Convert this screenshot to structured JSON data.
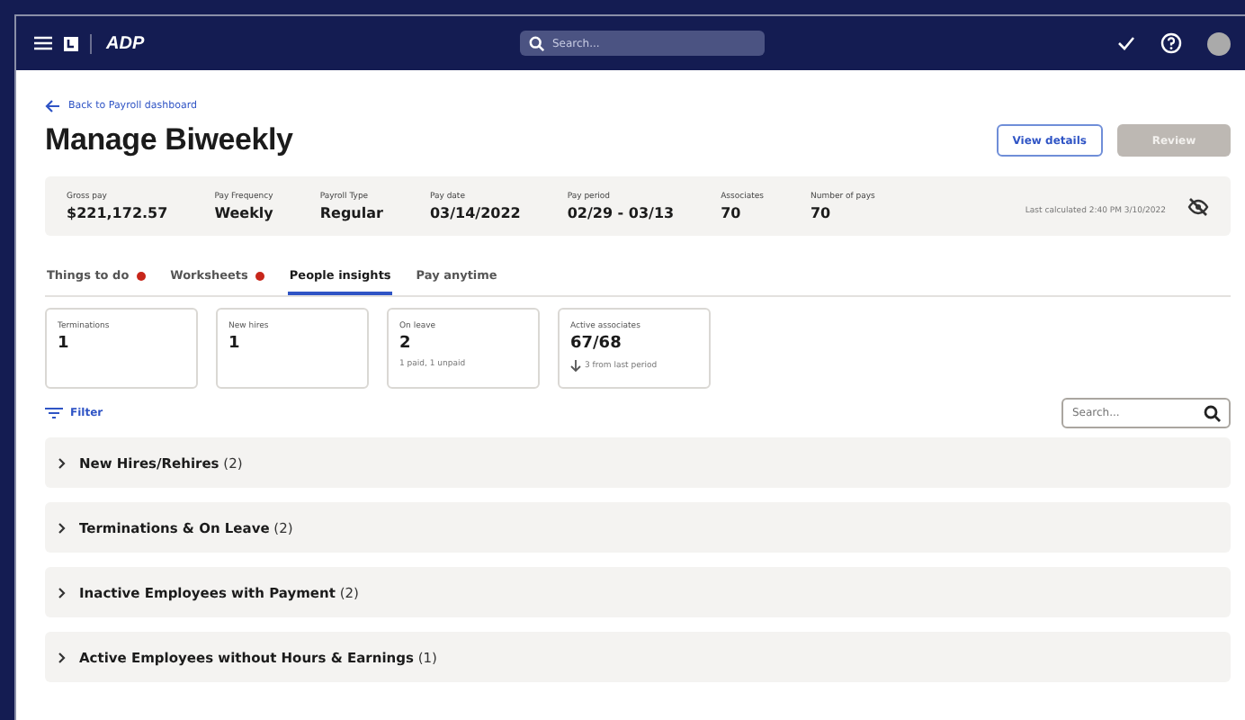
{
  "top_bar": {
    "logo": "ADP",
    "search": {
      "placeholder": "Search..."
    }
  },
  "back_link": "Back to Payroll dashboard",
  "title": "Manage Biweekly",
  "buttons": [
    {
      "label": "View details",
      "kind": "outline",
      "disabled": false
    },
    {
      "label": "Review",
      "kind": "filled",
      "disabled": true
    }
  ],
  "summary": {
    "fields": [
      {
        "label": "Gross pay",
        "value": "$221,172.57"
      },
      {
        "label": "Pay Frequency",
        "value": "Weekly"
      },
      {
        "label": "Payroll Type",
        "value": "Regular"
      },
      {
        "label": "Pay date",
        "value": "03/14/2022"
      },
      {
        "label": "Pay period",
        "value": "02/29 - 03/13"
      },
      {
        "label": "Associates",
        "value": "70"
      },
      {
        "label": "Number of pays",
        "value": "70"
      }
    ],
    "last_calculated": "Last calculated 2:40 PM 3/10/2022"
  },
  "tabs": [
    {
      "label": "Things to do",
      "selected": false,
      "alert": true
    },
    {
      "label": "Worksheets",
      "selected": false,
      "alert": true
    },
    {
      "label": "People insights",
      "selected": true,
      "alert": false
    },
    {
      "label": "Pay anytime",
      "selected": false,
      "alert": false
    }
  ],
  "cards": [
    {
      "label": "Terminations",
      "value": "1"
    },
    {
      "label": "New hires",
      "value": "1"
    },
    {
      "label": "On leave",
      "value": "2",
      "note": "1 paid, 1 unpaid"
    },
    {
      "label": "Active associates",
      "value": "67/68",
      "note": "3 from last period",
      "kind": "trend"
    }
  ],
  "filter": "Filter",
  "list_search": {
    "placeholder": "Search..."
  },
  "sections": [
    {
      "title": "New Hires/Rehires",
      "count": "(2)",
      "expanded": false
    },
    {
      "title": "Terminations & On Leave",
      "count": "(2)",
      "expanded": false
    },
    {
      "title": "Inactive Employees with Payment",
      "count": "(2)",
      "expanded": false
    },
    {
      "title": "Active Employees without Hours & Earnings",
      "count": "(1)",
      "expanded": false
    }
  ]
}
